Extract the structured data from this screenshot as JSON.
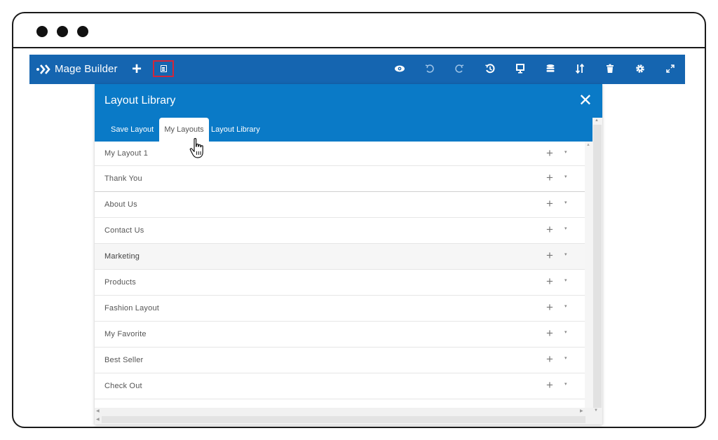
{
  "window": {
    "traffic_lights": [
      "close",
      "minimize",
      "maximize"
    ]
  },
  "toolbar": {
    "app_title": "Mage Builder",
    "add_label": "+",
    "icons": [
      "preview-eye-icon",
      "undo-icon",
      "redo-icon",
      "history-icon",
      "desktop-icon",
      "database-icon",
      "sort-icon",
      "trash-icon",
      "gear-icon",
      "expand-icon"
    ],
    "colors": {
      "toolbar_bg": "#1565b0",
      "highlight_border": "#d2263a"
    }
  },
  "panel": {
    "title": "Layout Library",
    "close_label": "✕",
    "tabs": [
      {
        "label": "Save Layout",
        "active": false
      },
      {
        "label": "My Layouts",
        "active": true
      },
      {
        "label": "Layout Library",
        "active": false
      }
    ],
    "header_color": "#0a7ac7",
    "rows": [
      {
        "label": "My Layout 1"
      },
      {
        "label": "Thank You"
      },
      {
        "label": "About Us"
      },
      {
        "label": "Contact Us"
      },
      {
        "label": "Marketing"
      },
      {
        "label": "Products"
      },
      {
        "label": "Fashion Layout"
      },
      {
        "label": "My Favorite"
      },
      {
        "label": "Best Seller"
      },
      {
        "label": "Check Out"
      }
    ],
    "row_add_label": "+",
    "row_caret_label": "▾"
  }
}
